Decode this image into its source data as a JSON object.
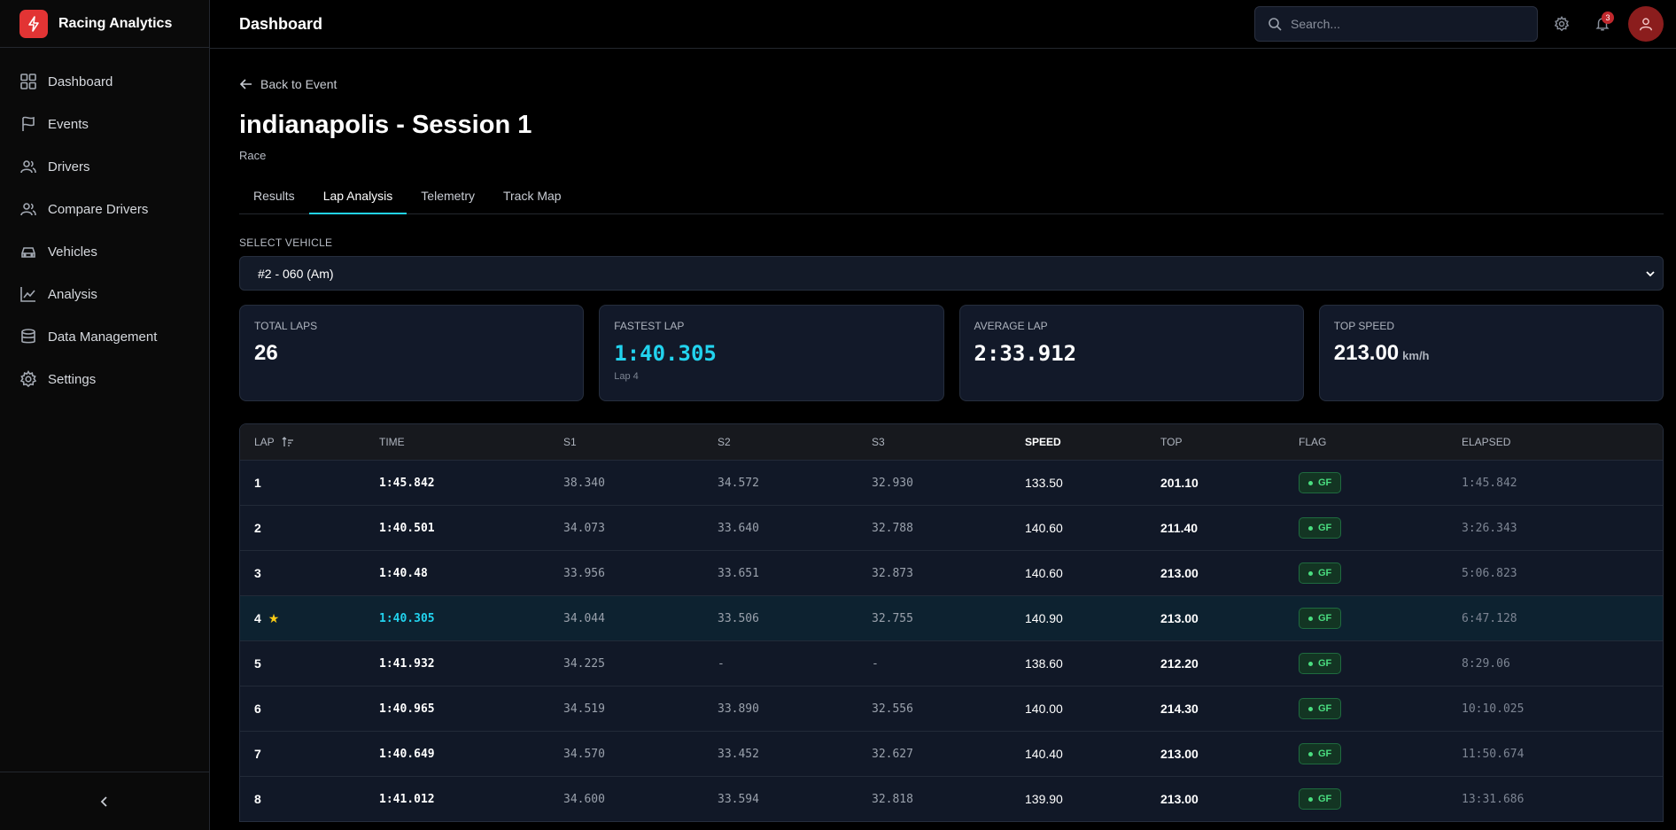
{
  "sidebar": {
    "brand": "Racing Analytics",
    "items": [
      {
        "label": "Dashboard",
        "icon": "grid-icon"
      },
      {
        "label": "Events",
        "icon": "flag-icon"
      },
      {
        "label": "Drivers",
        "icon": "users-icon"
      },
      {
        "label": "Compare Drivers",
        "icon": "users-compare-icon"
      },
      {
        "label": "Vehicles",
        "icon": "car-icon"
      },
      {
        "label": "Analysis",
        "icon": "chart-line-icon"
      },
      {
        "label": "Data Management",
        "icon": "database-icon"
      },
      {
        "label": "Settings",
        "icon": "gear-icon"
      }
    ]
  },
  "topbar": {
    "title": "Dashboard",
    "search_placeholder": "Search...",
    "notification_count": "3"
  },
  "page": {
    "back_label": "Back to Event",
    "title": "indianapolis - Session 1",
    "subtitle": "Race",
    "tabs": [
      "Results",
      "Lap Analysis",
      "Telemetry",
      "Track Map"
    ],
    "active_tab": "Lap Analysis",
    "select_label": "SELECT VEHICLE",
    "select_value": "#2 - 060 (Am)"
  },
  "stats": {
    "total_laps": {
      "label": "TOTAL LAPS",
      "value": "26"
    },
    "fastest_lap": {
      "label": "FASTEST LAP",
      "value": "1:40.305",
      "sub": "Lap 4"
    },
    "average_lap": {
      "label": "AVERAGE LAP",
      "value": "2:33.912"
    },
    "top_speed": {
      "label": "TOP SPEED",
      "value": "213.00",
      "unit": "km/h"
    }
  },
  "table": {
    "headers": {
      "lap": "LAP",
      "time": "TIME",
      "s1": "S1",
      "s2": "S2",
      "s3": "S3",
      "speed": "SPEED",
      "top": "TOP",
      "flag": "FLAG",
      "elapsed": "ELAPSED"
    },
    "rows": [
      {
        "lap": "1",
        "time": "1:45.842",
        "s1": "38.340",
        "s2": "34.572",
        "s3": "32.930",
        "speed": "133.50",
        "top": "201.10",
        "flag": "GF",
        "elapsed": "1:45.842"
      },
      {
        "lap": "2",
        "time": "1:40.501",
        "s1": "34.073",
        "s2": "33.640",
        "s3": "32.788",
        "speed": "140.60",
        "top": "211.40",
        "flag": "GF",
        "elapsed": "3:26.343"
      },
      {
        "lap": "3",
        "time": "1:40.48",
        "s1": "33.956",
        "s2": "33.651",
        "s3": "32.873",
        "speed": "140.60",
        "top": "213.00",
        "flag": "GF",
        "elapsed": "5:06.823"
      },
      {
        "lap": "4",
        "time": "1:40.305",
        "s1": "34.044",
        "s2": "33.506",
        "s3": "32.755",
        "speed": "140.90",
        "top": "213.00",
        "flag": "GF",
        "elapsed": "6:47.128"
      },
      {
        "lap": "5",
        "time": "1:41.932",
        "s1": "34.225",
        "s2": "-",
        "s3": "-",
        "speed": "138.60",
        "top": "212.20",
        "flag": "GF",
        "elapsed": "8:29.06"
      },
      {
        "lap": "6",
        "time": "1:40.965",
        "s1": "34.519",
        "s2": "33.890",
        "s3": "32.556",
        "speed": "140.00",
        "top": "214.30",
        "flag": "GF",
        "elapsed": "10:10.025"
      },
      {
        "lap": "7",
        "time": "1:40.649",
        "s1": "34.570",
        "s2": "33.452",
        "s3": "32.627",
        "speed": "140.40",
        "top": "213.00",
        "flag": "GF",
        "elapsed": "11:50.674"
      },
      {
        "lap": "8",
        "time": "1:41.012",
        "s1": "34.600",
        "s2": "33.594",
        "s3": "32.818",
        "speed": "139.90",
        "top": "213.00",
        "flag": "GF",
        "elapsed": "13:31.686"
      }
    ]
  },
  "colors": {
    "accent": "#22d3ee",
    "brand": "#e23434",
    "flag_green": "#4ade80",
    "star": "#facc15"
  }
}
